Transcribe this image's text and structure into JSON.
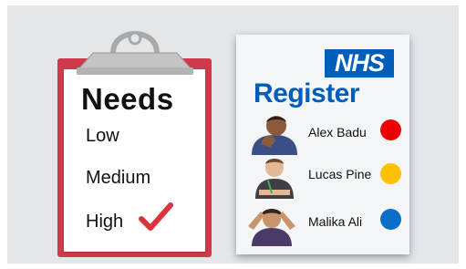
{
  "needs_card": {
    "title": "Needs",
    "levels": [
      "Low",
      "Medium",
      "High"
    ],
    "selected_level": "High",
    "tick_icon": "checkmark-icon"
  },
  "register_card": {
    "logo": "NHS",
    "title": "Register",
    "people": [
      {
        "name": "Alex Badu",
        "status_color": "#ee0000"
      },
      {
        "name": "Lucas Pine",
        "status_color": "#ffc000"
      },
      {
        "name": "Malika Ali",
        "status_color": "#0a6dc8"
      }
    ]
  },
  "colors": {
    "clipboard": "#cf3a4a",
    "nhs_blue": "#005eb8",
    "tick": "#d9343f"
  }
}
